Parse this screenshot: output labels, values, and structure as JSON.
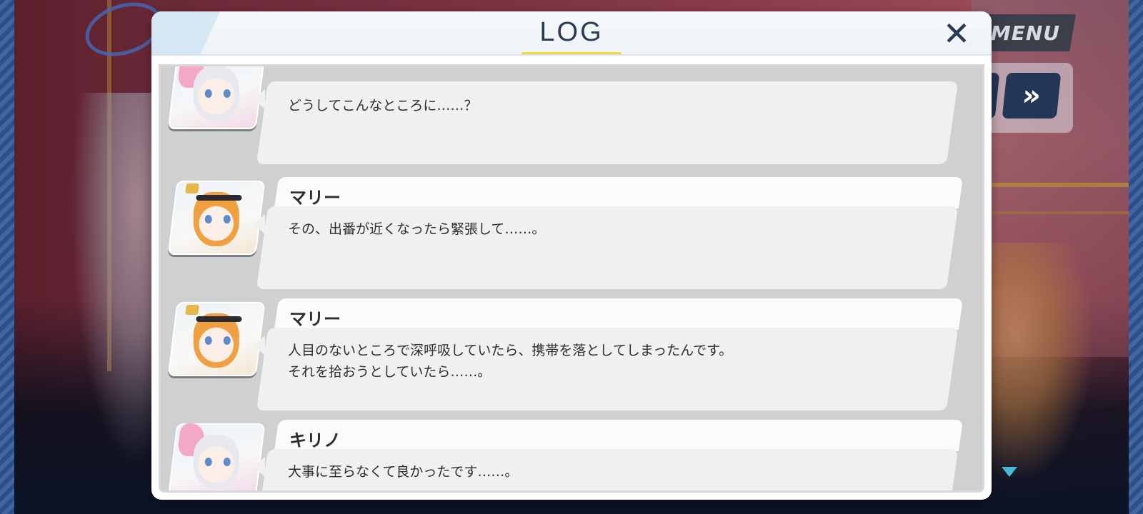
{
  "window": {
    "title": "LOG"
  },
  "controls": {
    "menu_label": "MENU",
    "fast_forward_icon": "»"
  },
  "log": {
    "entries": [
      {
        "name": "",
        "lines": [
          "どうしてこんなところに……？"
        ]
      },
      {
        "name": "マリー",
        "lines": [
          "その、出番が近くなったら緊張して……。"
        ]
      },
      {
        "name": "マリー",
        "lines": [
          "人目のないところで深呼吸していたら、携帯を落としてしまったんです。",
          "それを拾おうとしていたら……。"
        ]
      },
      {
        "name": "キリノ",
        "lines": [
          "大事に至らなくて良かったです……。"
        ]
      }
    ]
  },
  "colors": {
    "accent_underline": "#f3d738",
    "title_text": "#2b3a55",
    "bubble_bg": "#f0f0ee",
    "scroll_arrow": "#43b8d8"
  }
}
